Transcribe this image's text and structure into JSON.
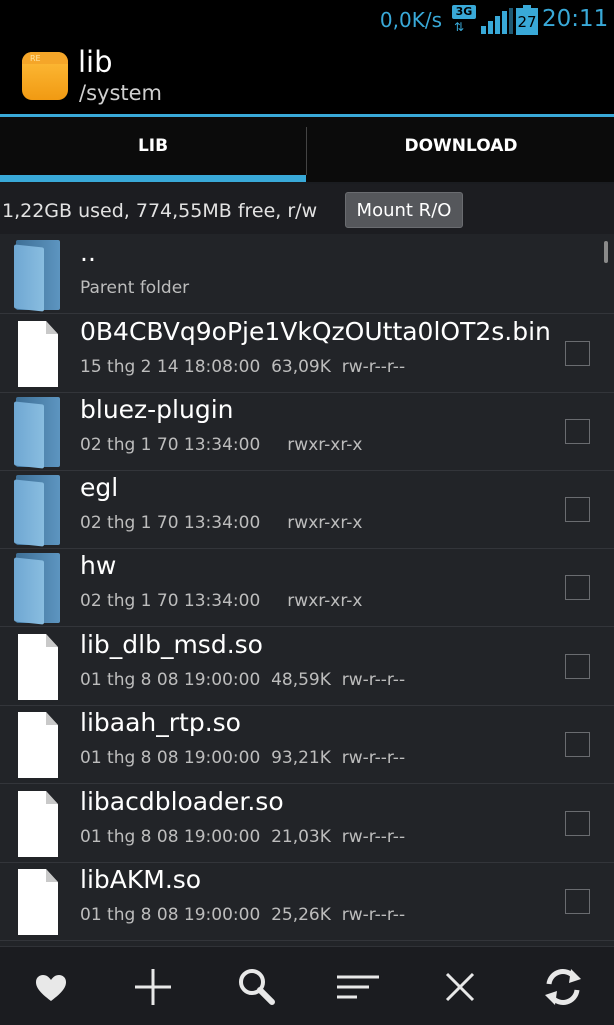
{
  "status": {
    "net_speed": "0,0K/s",
    "network_type": "3G",
    "network_arrows": "⇅",
    "battery": "27",
    "time": "20:11"
  },
  "header": {
    "title": "lib",
    "path": "/system",
    "app_icon_text": "RE"
  },
  "tabs": [
    {
      "label": "LIB"
    },
    {
      "label": "DOWNLOAD"
    }
  ],
  "info": {
    "storage": "1,22GB used, 774,55MB free, r/w",
    "mount_label": "Mount R/O"
  },
  "files": [
    {
      "type": "folder",
      "name": "..",
      "meta": "Parent folder"
    },
    {
      "type": "file",
      "name": "0B4CBVq9oPje1VkQzOUtta0lOT2s.bin",
      "meta": "15 thg 2 14 18:08:00  63,09K  rw-r--r--"
    },
    {
      "type": "folder",
      "name": "bluez-plugin",
      "meta": "02 thg 1 70 13:34:00     rwxr-xr-x"
    },
    {
      "type": "folder",
      "name": "egl",
      "meta": "02 thg 1 70 13:34:00     rwxr-xr-x"
    },
    {
      "type": "folder",
      "name": "hw",
      "meta": "02 thg 1 70 13:34:00     rwxr-xr-x"
    },
    {
      "type": "file",
      "name": "lib_dlb_msd.so",
      "meta": "01 thg 8 08 19:00:00  48,59K  rw-r--r--"
    },
    {
      "type": "file",
      "name": "libaah_rtp.so",
      "meta": "01 thg 8 08 19:00:00  93,21K  rw-r--r--"
    },
    {
      "type": "file",
      "name": "libacdbloader.so",
      "meta": "01 thg 8 08 19:00:00  21,03K  rw-r--r--"
    },
    {
      "type": "file",
      "name": "libAKM.so",
      "meta": "01 thg 8 08 19:00:00  25,26K  rw-r--r--"
    }
  ],
  "toolbar": [
    "heart-icon",
    "plus-icon",
    "search-icon",
    "sort-icon",
    "close-icon",
    "refresh-icon"
  ],
  "colors": {
    "accent": "#39a9d8",
    "background": "#222428"
  }
}
